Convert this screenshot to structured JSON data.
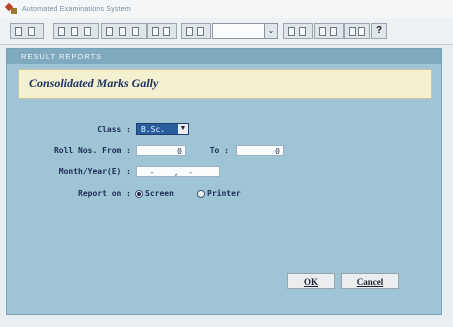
{
  "window": {
    "title": "Automated Examinations System"
  },
  "toolbar": {
    "combo_value": "",
    "combo_arrow": "⌄",
    "help_symbol": "?"
  },
  "panel": {
    "header": "RESULT REPORTS",
    "title": "Consolidated Marks Gally"
  },
  "form": {
    "class_label": "Class :",
    "class_value": "B.Sc.",
    "roll_from_label": "Roll Nos. From :",
    "roll_from_value": "0",
    "roll_to_label": "To :",
    "roll_to_value": "0",
    "month_year_label": "Month/Year(E) :",
    "month_year_value": "  -    ,  -  ",
    "report_on_label": "Report on :",
    "report_options": [
      "Screen",
      "Printer"
    ],
    "report_selected": "Screen"
  },
  "buttons": {
    "ok": "OK",
    "cancel": "Cancel"
  },
  "colors": {
    "panel": "#9fc4d6",
    "header": "#7fa9bf",
    "title_box": "#f3f1cf",
    "select": "#2a5d9e"
  }
}
